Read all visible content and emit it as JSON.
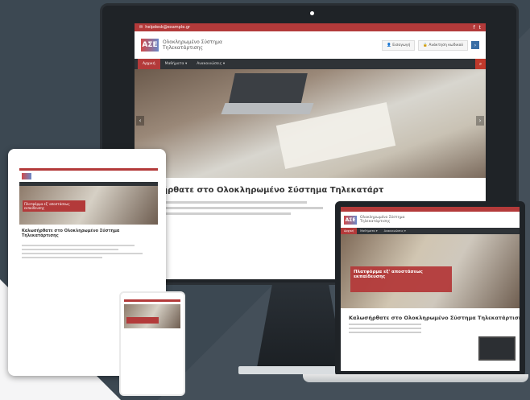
{
  "desktop": {
    "top_email": "helpdesk@example.gr",
    "logo_mark": "ΑΣΕ",
    "site_title_line1": "Ολοκληρωμένο Σύστημα",
    "site_title_line2": "Τηλεκατάρτισης",
    "login_label": "Εισαγωγή",
    "register_label": "Ανάκτηση κωδικού",
    "nav": [
      "Αρχική",
      "Μαθήματα ▾",
      "Ανακοινώσεις ▾"
    ],
    "welcome": "ήρθατε στο Ολοκληρωμένο Σύστημα Τηλεκατάρτ"
  },
  "tablet": {
    "banner": "Πλατφόρμα εξ' αποστάσεως εκπαίδευσης",
    "welcome": "Καλωσήρθατε στο Ολοκληρωμένο Σύστημα Τηλεκατάρτισης"
  },
  "laptop": {
    "logo_mark": "ΑΣΕ",
    "title_line1": "Ολοκληρωμένο Σύστημα",
    "title_line2": "Τηλεκατάρτισης",
    "nav": [
      "Αρχική",
      "Μαθήματα ▾",
      "Ανακοινώσεις ▾"
    ],
    "banner_title_1": "Πλατφόρμα εξ' αποστάσεως",
    "banner_title_2": "εκπαίδευσης",
    "welcome": "Καλωσήρθατε στο Ολοκληρωμένο Σύστημα Τηλεκατάρτισης"
  }
}
